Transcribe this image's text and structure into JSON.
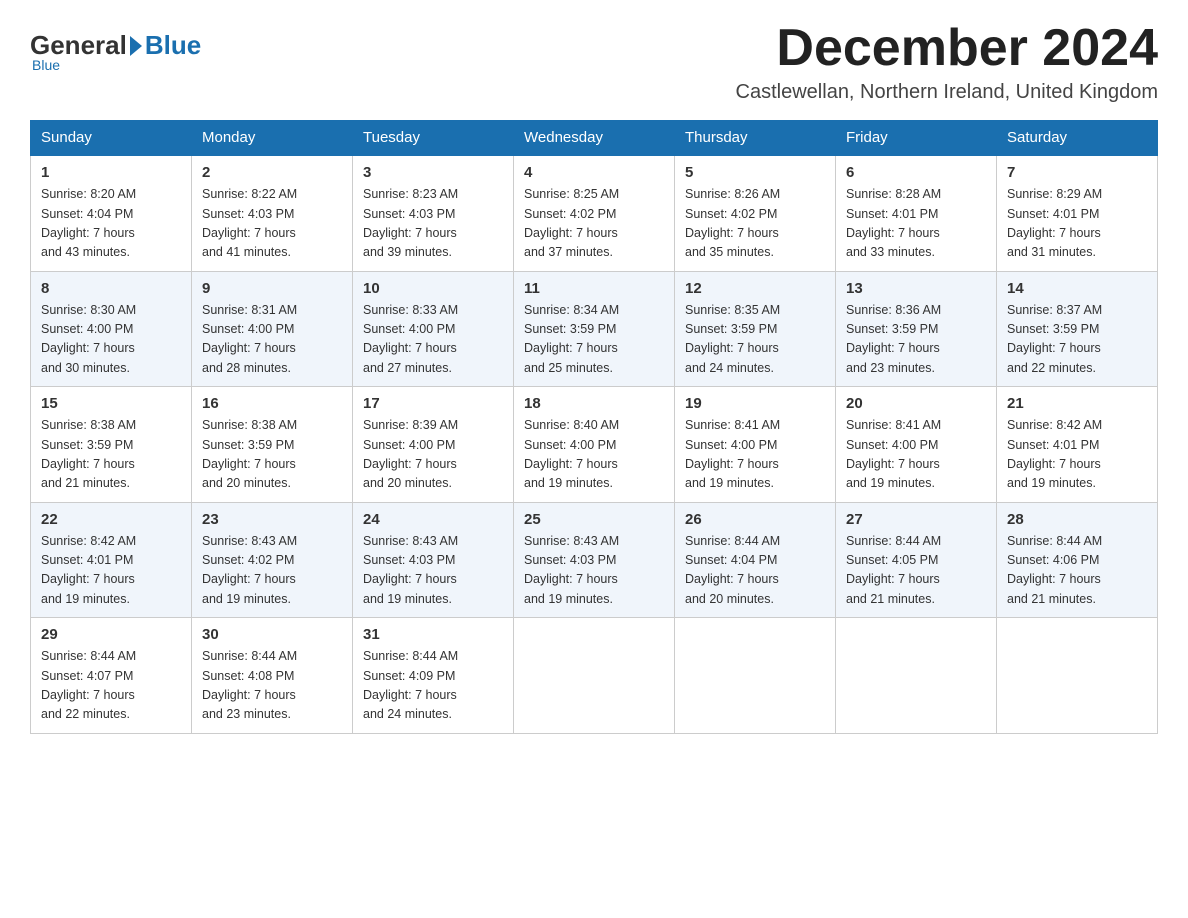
{
  "header": {
    "logo": {
      "general": "General",
      "blue": "Blue",
      "sub": "Blue"
    },
    "title": "December 2024",
    "location": "Castlewellan, Northern Ireland, United Kingdom"
  },
  "weekdays": [
    "Sunday",
    "Monday",
    "Tuesday",
    "Wednesday",
    "Thursday",
    "Friday",
    "Saturday"
  ],
  "weeks": [
    [
      {
        "day": "1",
        "info": "Sunrise: 8:20 AM\nSunset: 4:04 PM\nDaylight: 7 hours\nand 43 minutes."
      },
      {
        "day": "2",
        "info": "Sunrise: 8:22 AM\nSunset: 4:03 PM\nDaylight: 7 hours\nand 41 minutes."
      },
      {
        "day": "3",
        "info": "Sunrise: 8:23 AM\nSunset: 4:03 PM\nDaylight: 7 hours\nand 39 minutes."
      },
      {
        "day": "4",
        "info": "Sunrise: 8:25 AM\nSunset: 4:02 PM\nDaylight: 7 hours\nand 37 minutes."
      },
      {
        "day": "5",
        "info": "Sunrise: 8:26 AM\nSunset: 4:02 PM\nDaylight: 7 hours\nand 35 minutes."
      },
      {
        "day": "6",
        "info": "Sunrise: 8:28 AM\nSunset: 4:01 PM\nDaylight: 7 hours\nand 33 minutes."
      },
      {
        "day": "7",
        "info": "Sunrise: 8:29 AM\nSunset: 4:01 PM\nDaylight: 7 hours\nand 31 minutes."
      }
    ],
    [
      {
        "day": "8",
        "info": "Sunrise: 8:30 AM\nSunset: 4:00 PM\nDaylight: 7 hours\nand 30 minutes."
      },
      {
        "day": "9",
        "info": "Sunrise: 8:31 AM\nSunset: 4:00 PM\nDaylight: 7 hours\nand 28 minutes."
      },
      {
        "day": "10",
        "info": "Sunrise: 8:33 AM\nSunset: 4:00 PM\nDaylight: 7 hours\nand 27 minutes."
      },
      {
        "day": "11",
        "info": "Sunrise: 8:34 AM\nSunset: 3:59 PM\nDaylight: 7 hours\nand 25 minutes."
      },
      {
        "day": "12",
        "info": "Sunrise: 8:35 AM\nSunset: 3:59 PM\nDaylight: 7 hours\nand 24 minutes."
      },
      {
        "day": "13",
        "info": "Sunrise: 8:36 AM\nSunset: 3:59 PM\nDaylight: 7 hours\nand 23 minutes."
      },
      {
        "day": "14",
        "info": "Sunrise: 8:37 AM\nSunset: 3:59 PM\nDaylight: 7 hours\nand 22 minutes."
      }
    ],
    [
      {
        "day": "15",
        "info": "Sunrise: 8:38 AM\nSunset: 3:59 PM\nDaylight: 7 hours\nand 21 minutes."
      },
      {
        "day": "16",
        "info": "Sunrise: 8:38 AM\nSunset: 3:59 PM\nDaylight: 7 hours\nand 20 minutes."
      },
      {
        "day": "17",
        "info": "Sunrise: 8:39 AM\nSunset: 4:00 PM\nDaylight: 7 hours\nand 20 minutes."
      },
      {
        "day": "18",
        "info": "Sunrise: 8:40 AM\nSunset: 4:00 PM\nDaylight: 7 hours\nand 19 minutes."
      },
      {
        "day": "19",
        "info": "Sunrise: 8:41 AM\nSunset: 4:00 PM\nDaylight: 7 hours\nand 19 minutes."
      },
      {
        "day": "20",
        "info": "Sunrise: 8:41 AM\nSunset: 4:00 PM\nDaylight: 7 hours\nand 19 minutes."
      },
      {
        "day": "21",
        "info": "Sunrise: 8:42 AM\nSunset: 4:01 PM\nDaylight: 7 hours\nand 19 minutes."
      }
    ],
    [
      {
        "day": "22",
        "info": "Sunrise: 8:42 AM\nSunset: 4:01 PM\nDaylight: 7 hours\nand 19 minutes."
      },
      {
        "day": "23",
        "info": "Sunrise: 8:43 AM\nSunset: 4:02 PM\nDaylight: 7 hours\nand 19 minutes."
      },
      {
        "day": "24",
        "info": "Sunrise: 8:43 AM\nSunset: 4:03 PM\nDaylight: 7 hours\nand 19 minutes."
      },
      {
        "day": "25",
        "info": "Sunrise: 8:43 AM\nSunset: 4:03 PM\nDaylight: 7 hours\nand 19 minutes."
      },
      {
        "day": "26",
        "info": "Sunrise: 8:44 AM\nSunset: 4:04 PM\nDaylight: 7 hours\nand 20 minutes."
      },
      {
        "day": "27",
        "info": "Sunrise: 8:44 AM\nSunset: 4:05 PM\nDaylight: 7 hours\nand 21 minutes."
      },
      {
        "day": "28",
        "info": "Sunrise: 8:44 AM\nSunset: 4:06 PM\nDaylight: 7 hours\nand 21 minutes."
      }
    ],
    [
      {
        "day": "29",
        "info": "Sunrise: 8:44 AM\nSunset: 4:07 PM\nDaylight: 7 hours\nand 22 minutes."
      },
      {
        "day": "30",
        "info": "Sunrise: 8:44 AM\nSunset: 4:08 PM\nDaylight: 7 hours\nand 23 minutes."
      },
      {
        "day": "31",
        "info": "Sunrise: 8:44 AM\nSunset: 4:09 PM\nDaylight: 7 hours\nand 24 minutes."
      },
      {
        "day": "",
        "info": ""
      },
      {
        "day": "",
        "info": ""
      },
      {
        "day": "",
        "info": ""
      },
      {
        "day": "",
        "info": ""
      }
    ]
  ]
}
